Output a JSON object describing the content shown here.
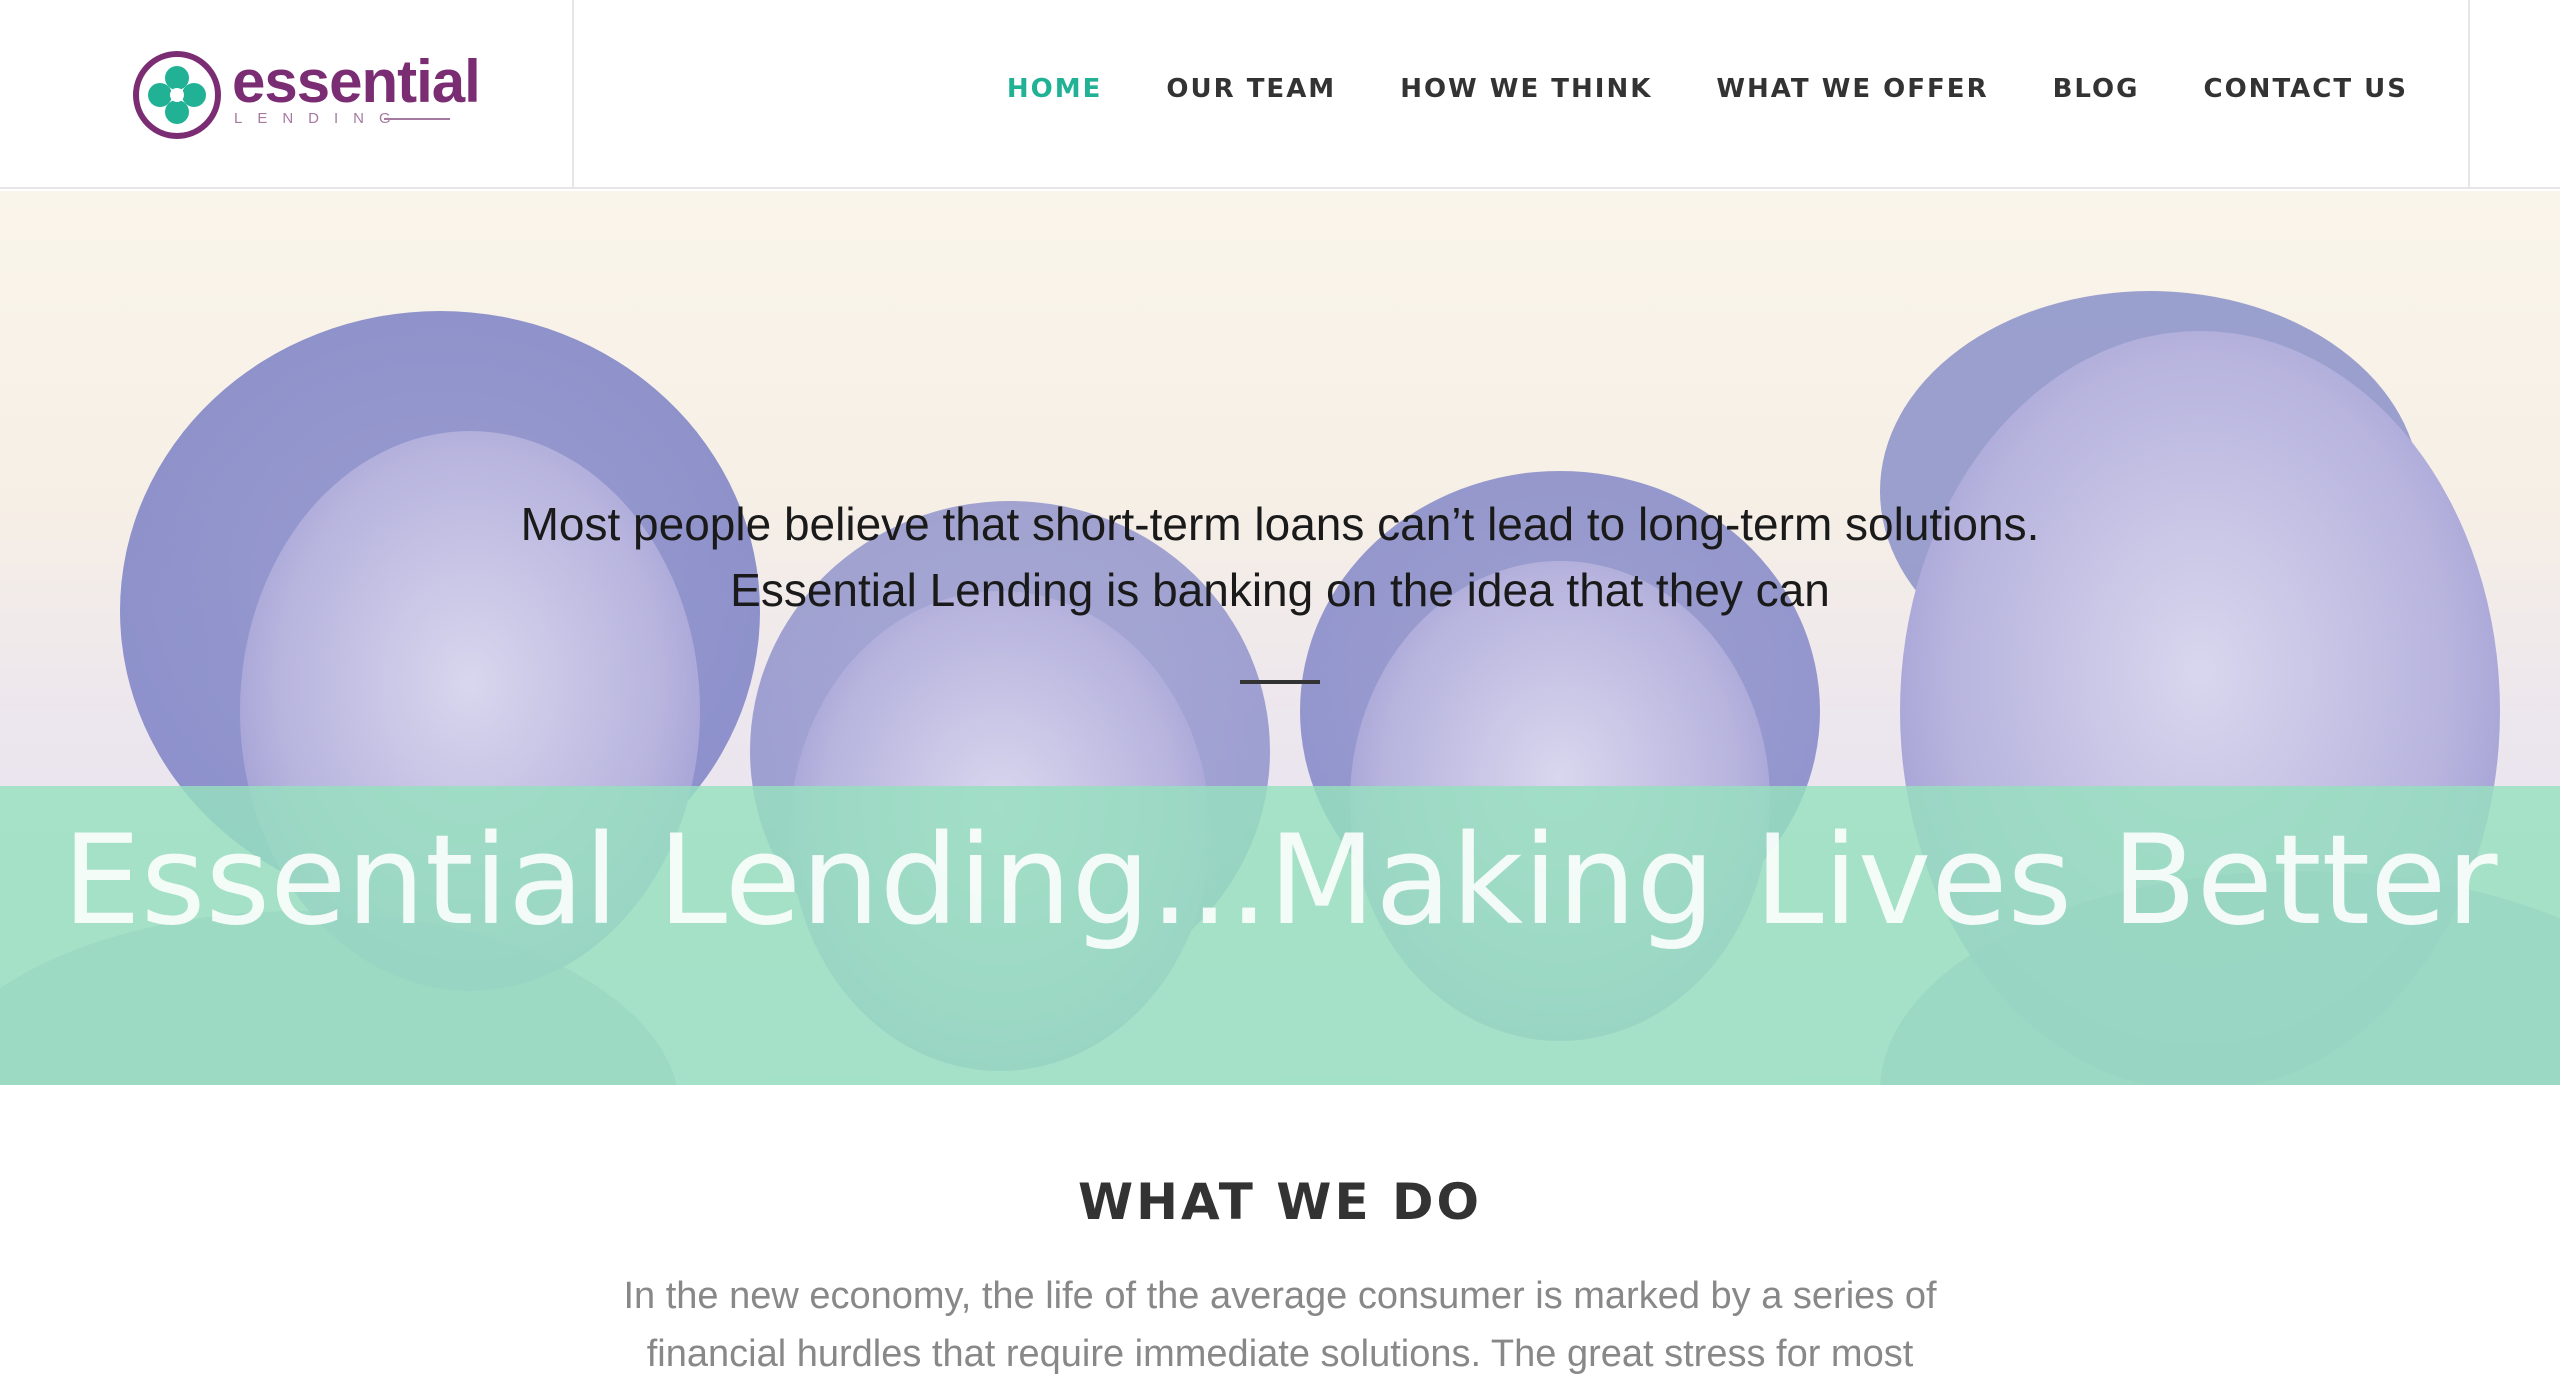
{
  "header": {
    "logo": {
      "name": "essential",
      "subtitle": "LENDING"
    },
    "nav": [
      {
        "label": "HOME",
        "active": true
      },
      {
        "label": "OUR TEAM",
        "active": false
      },
      {
        "label": "HOW WE THINK",
        "active": false
      },
      {
        "label": "WHAT WE OFFER",
        "active": false
      },
      {
        "label": "BLOG",
        "active": false
      },
      {
        "label": "CONTACT US",
        "active": false
      }
    ]
  },
  "hero": {
    "quote_lines": [
      "Most people believe that short-term loans can’t lead to long-term solutions.",
      "Essential Lending is banking on the idea that they can"
    ],
    "tagline": "Essential Lending...Making Lives Better"
  },
  "what_we_do": {
    "heading": "WHAT WE DO",
    "paragraph_lines": [
      "In the new economy, the life of the average consumer is marked by a series of",
      "financial hurdles that require immediate solutions. The great stress for most"
    ]
  },
  "colors": {
    "brand_purple": "#7b2d74",
    "brand_teal": "#21b296",
    "band_green": "#96e1be",
    "nav_text": "#333333"
  }
}
